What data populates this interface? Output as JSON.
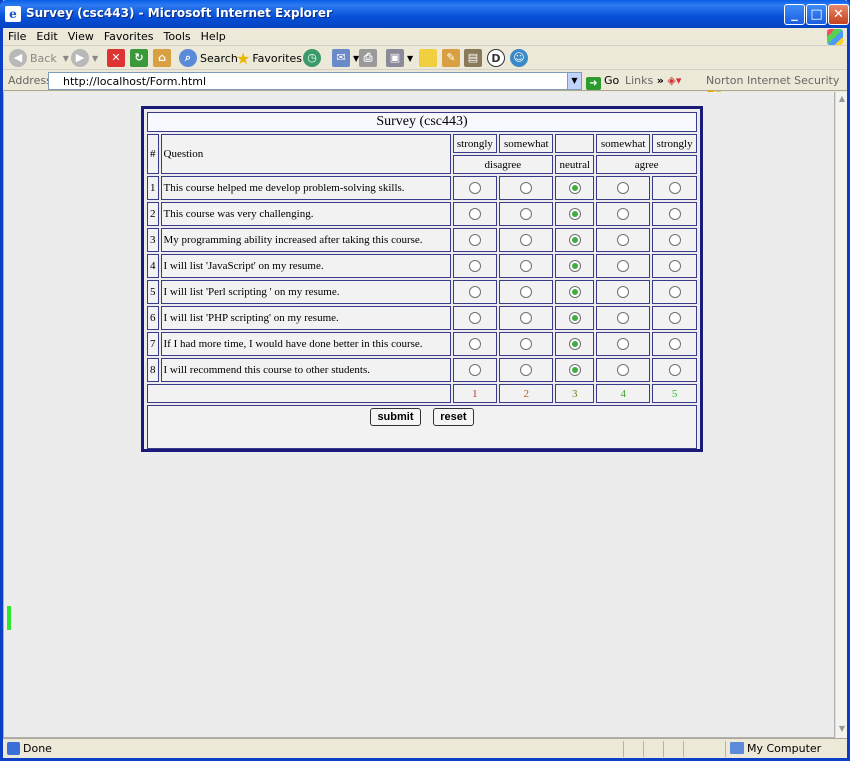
{
  "window": {
    "title": "Survey (csc443) - Microsoft Internet Explorer"
  },
  "menu": [
    "File",
    "Edit",
    "View",
    "Favorites",
    "Tools",
    "Help"
  ],
  "toolbar": {
    "back": "Back",
    "search": "Search",
    "favorites": "Favorites"
  },
  "address": {
    "label": "Address",
    "url": "http://localhost/Form.html",
    "go": "Go",
    "links": "Links",
    "norton": "Norton Internet Security"
  },
  "survey": {
    "title": "Survey (csc443)",
    "col_number": "#",
    "col_question": "Question",
    "scale_top": [
      "strongly",
      "somewhat",
      "",
      "somewhat",
      "strongly"
    ],
    "scale_groups": {
      "disagree": "disagree",
      "neutral": "neutral",
      "agree": "agree"
    },
    "questions": [
      {
        "n": "1",
        "text": "This course helped me develop problem-solving skills.",
        "selected": 3
      },
      {
        "n": "2",
        "text": "This course was very challenging.",
        "selected": 3
      },
      {
        "n": "3",
        "text": "My programming ability increased after taking this course.",
        "selected": 3
      },
      {
        "n": "4",
        "text": "I will list 'JavaScript' on my resume.",
        "selected": 3
      },
      {
        "n": "5",
        "text": "I will list 'Perl scripting ' on my resume.",
        "selected": 3
      },
      {
        "n": "6",
        "text": "I will list 'PHP scripting' on my resume.",
        "selected": 3
      },
      {
        "n": "7",
        "text": "If I had more time, I would have done better in this course.",
        "selected": 3
      },
      {
        "n": "8",
        "text": "I will recommend this course to other students.",
        "selected": 3
      }
    ],
    "scale_numbers": [
      "1",
      "2",
      "3",
      "4",
      "5"
    ],
    "scale_colors": [
      "#d03020",
      "#c06020",
      "#808020",
      "#40a030",
      "#30c030"
    ],
    "submit_label": "submit",
    "reset_label": "reset"
  },
  "status": {
    "text": "Done",
    "zone": "My Computer"
  }
}
